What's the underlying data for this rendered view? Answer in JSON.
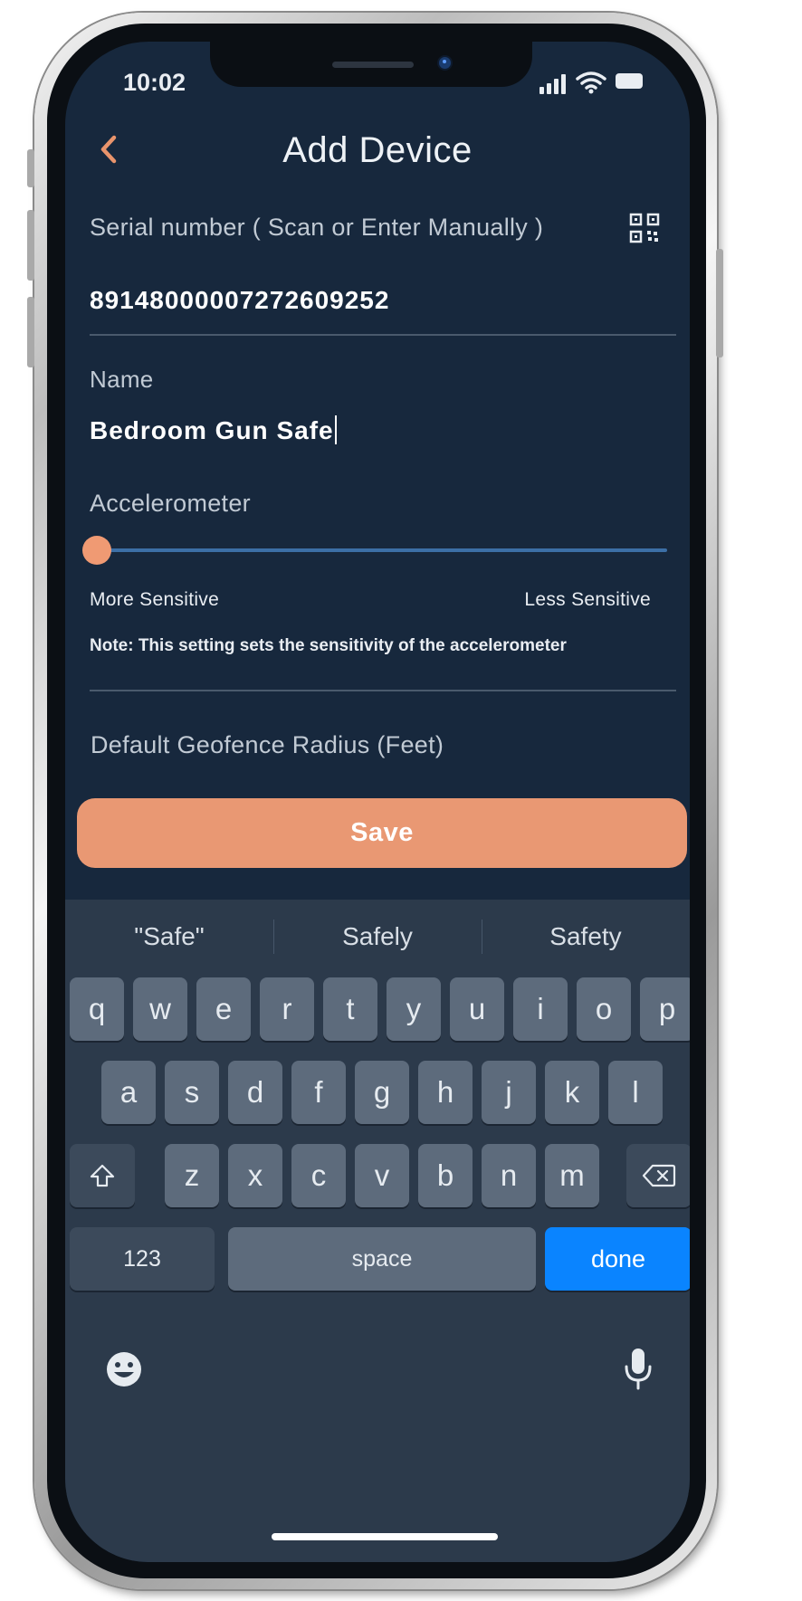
{
  "status_bar": {
    "time": "10:02"
  },
  "header": {
    "title": "Add Device"
  },
  "form": {
    "serial_label": "Serial number ( Scan or Enter Manually )",
    "serial_value": "89148000007272609252",
    "name_label": "Name",
    "name_value": "Bedroom Gun Safe",
    "accelerometer_label": "Accelerometer",
    "accelerometer_level": 0,
    "more_sensitive": "More Sensitive",
    "less_sensitive": "Less Sensitive",
    "note": "Note: This setting sets the sensitivity of the accelerometer",
    "geofence_label": "Default Geofence Radius (Feet)",
    "save_label": "Save"
  },
  "keyboard": {
    "suggestions": [
      "\"Safe\"",
      "Safely",
      "Safety"
    ],
    "row1": [
      "q",
      "w",
      "e",
      "r",
      "t",
      "y",
      "u",
      "i",
      "o",
      "p"
    ],
    "row2": [
      "a",
      "s",
      "d",
      "f",
      "g",
      "h",
      "j",
      "k",
      "l"
    ],
    "row3": [
      "z",
      "x",
      "c",
      "v",
      "b",
      "n",
      "m"
    ],
    "numbers_key": "123",
    "space_key": "space",
    "done_key": "done"
  },
  "colors": {
    "background": "#17283d",
    "accent": "#e99873",
    "slider": "#3c6fa6",
    "done": "#0a84ff"
  },
  "icons": [
    "back-chevron-icon",
    "qr-code-icon",
    "signal-icon",
    "wifi-icon",
    "battery-icon",
    "shift-icon",
    "backspace-icon",
    "emoji-icon",
    "microphone-icon"
  ]
}
